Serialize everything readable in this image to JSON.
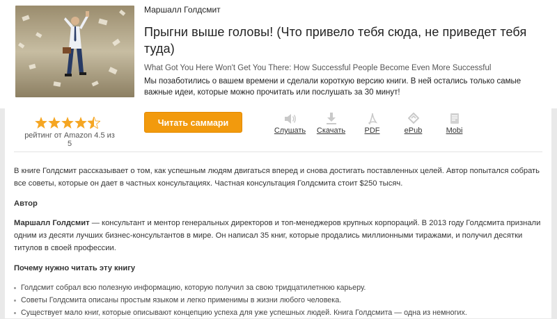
{
  "book": {
    "author": "Маршалл Голдсмит",
    "title": "Прыгни выше головы! (Что привело тебя сюда, не приведет тебя туда)",
    "original_title": "What Got You Here Won't Get You There: How Successful People Become Even More Successful",
    "description": "Мы позаботились о вашем времени и сделали короткую версию книги. В ней остались только самые важные идеи, которые можно прочитать или послушать за 30 минут!"
  },
  "rating": {
    "stars": 4.5,
    "text": "рейтинг от Amazon 4.5 из 5",
    "color": "#f5a623"
  },
  "actions": {
    "read_label": "Читать саммари",
    "items": [
      {
        "label": "Слушать",
        "icon": "speaker-icon"
      },
      {
        "label": "Скачать",
        "icon": "download-icon"
      },
      {
        "label": "PDF",
        "icon": "pdf-icon"
      },
      {
        "label": "ePub",
        "icon": "epub-icon"
      },
      {
        "label": "Mobi",
        "icon": "mobi-icon"
      }
    ]
  },
  "content": {
    "intro": "В книге Голдсмит рассказывает о том, как успешным людям двигаться вперед и снова достигать поставленных целей. Автор попытался собрать все советы, которые он дает в частных консультациях. Частная консультация Голдсмита стоит $250 тысяч.",
    "author_heading": "Автор",
    "author_name": "Маршалл Голдсмит",
    "author_bio": " — консультант и ментор генеральных директоров и топ-менеджеров крупных корпораций. В 2013 году Голдсмита признали одним из десяти лучших бизнес-консультантов в мире. Он написал 35 книг, которые продались миллионными тиражами, и получил десятки титулов в своей профессии.",
    "why_heading": "Почему нужно читать эту книгу",
    "reasons": [
      "Голдсмит собрал всю полезную информацию, которую получил за свою тридцатилетнюю карьеру.",
      "Советы Голдсмита описаны простым языком и легко применимы в жизни любого человека.",
      "Существует мало книг, которые описывают концепцию успеха для уже успешных людей. Книга Голдсмита — одна из немногих."
    ]
  },
  "colors": {
    "accent": "#f29a0d",
    "background": "#e9e9e9"
  }
}
